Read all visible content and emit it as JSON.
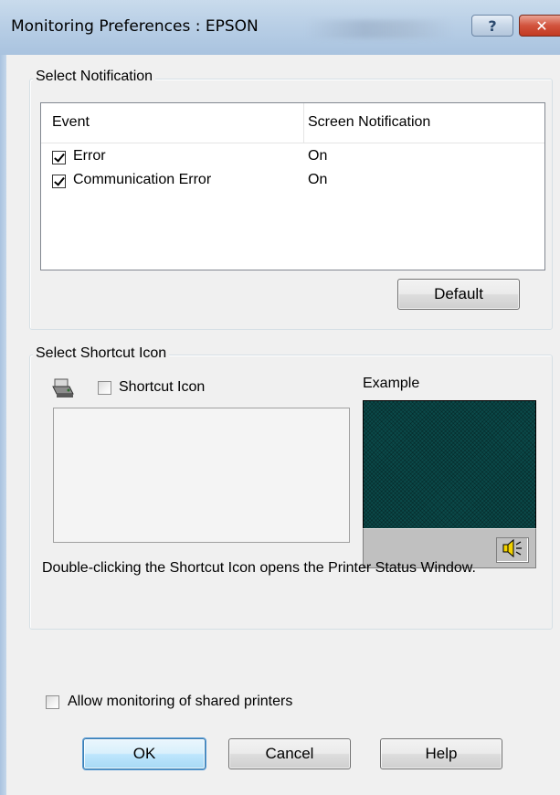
{
  "window": {
    "title": "Monitoring Preferences : EPSON",
    "help_button": "?",
    "close_button": "✕"
  },
  "select_notification": {
    "group_label": "Select Notification",
    "columns": [
      "Event",
      "Screen Notification"
    ],
    "rows": [
      {
        "event": "Error",
        "notification": "On",
        "checked": true
      },
      {
        "event": "Communication Error",
        "notification": "On",
        "checked": true
      }
    ],
    "default_button": "Default"
  },
  "select_shortcut_icon": {
    "group_label": "Select Shortcut Icon",
    "checkbox_label": "Shortcut Icon",
    "checked": false,
    "example_label": "Example",
    "description": "Double-clicking the Shortcut Icon opens the Printer Status Window.",
    "printer_icon": "printer-icon",
    "speaker_icon": "speaker-icon",
    "example_desktop_color": "#0b4a4a"
  },
  "shared": {
    "checkbox_label": "Allow monitoring of shared printers",
    "checked": false
  },
  "buttons": {
    "ok": "OK",
    "cancel": "Cancel",
    "help": "Help"
  },
  "colors": {
    "dialog_bg": "#f0f0f0",
    "titlebar": "#b9cfe6",
    "close_red": "#c23a22",
    "default_button_border": "#3c7fb1"
  }
}
